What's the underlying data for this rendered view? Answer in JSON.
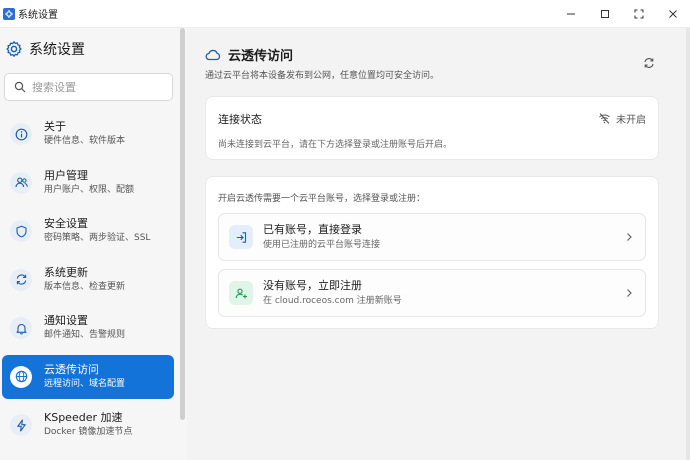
{
  "window": {
    "title": "系统设置"
  },
  "sidebar": {
    "title": "系统设置",
    "search_placeholder": "搜索设置",
    "items": [
      {
        "label": "关于",
        "sub": "硬件信息、软件版本",
        "icon": "info-icon"
      },
      {
        "label": "用户管理",
        "sub": "用户账户、权限、配额",
        "icon": "users-icon"
      },
      {
        "label": "安全设置",
        "sub": "密码策略、两步验证、SSL",
        "icon": "shield-icon"
      },
      {
        "label": "系统更新",
        "sub": "版本信息、检查更新",
        "icon": "refresh-icon"
      },
      {
        "label": "通知设置",
        "sub": "邮件通知、告警规则",
        "icon": "bell-icon"
      },
      {
        "label": "云透传访问",
        "sub": "远程访问、域名配置",
        "icon": "globe-icon",
        "active": true
      },
      {
        "label": "KSpeeder 加速",
        "sub": "Docker 镜像加速节点",
        "icon": "lightning-icon"
      }
    ]
  },
  "main": {
    "title": "云透传访问",
    "subtitle": "通过云平台将本设备发布到公网，任意位置均可安全访问。",
    "status": {
      "title": "连接状态",
      "badge": "未开启",
      "description": "尚未连接到云平台，请在下方选择登录或注册账号后开启。"
    },
    "options": {
      "intro": "开启云透传需要一个云平台账号，选择登录或注册：",
      "login": {
        "title": "已有账号，直接登录",
        "sub": "使用已注册的云平台账号连接"
      },
      "register": {
        "title": "没有账号，立即注册",
        "sub": "在 cloud.roceos.com 注册新账号"
      }
    }
  },
  "colors": {
    "accent": "#1473d9",
    "login_icon_bg": "#e4eefb",
    "register_icon_bg": "#dff5e8"
  }
}
